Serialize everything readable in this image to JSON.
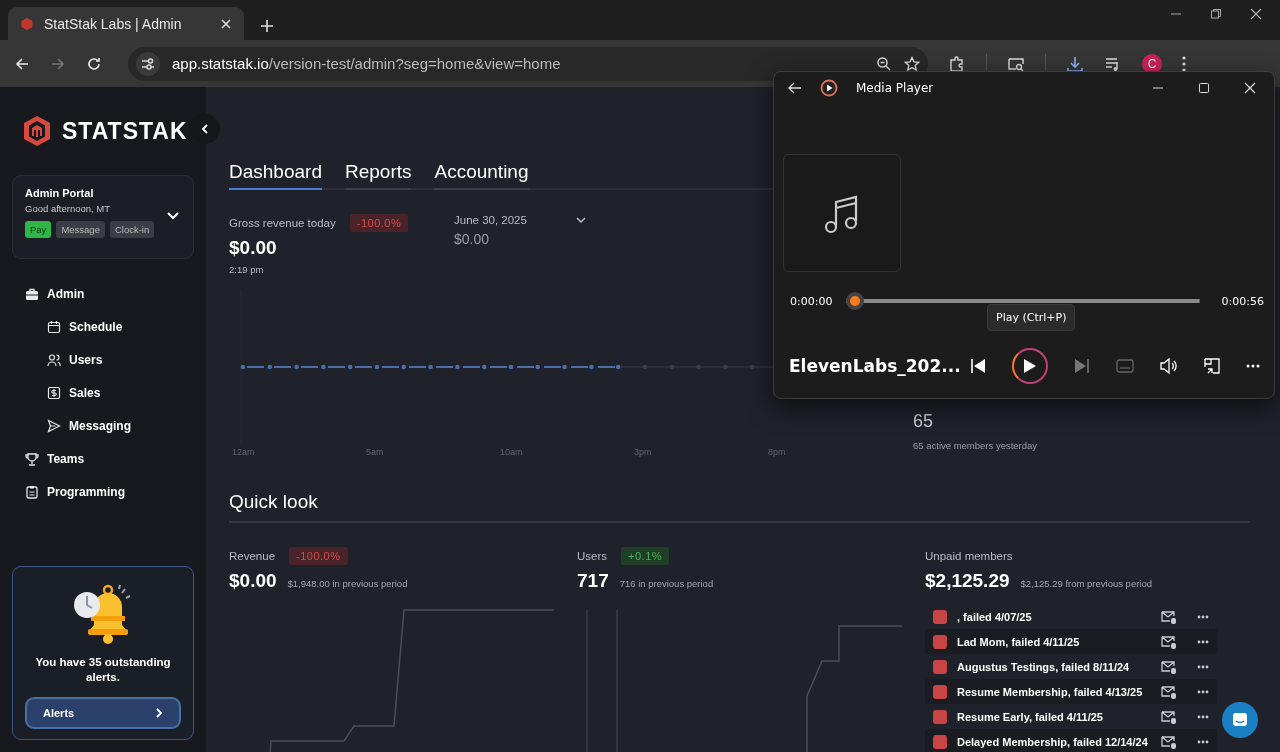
{
  "browser": {
    "tab_title": "StatStak Labs | Admin",
    "url_host": "app.statstak.io",
    "url_path": "/version-test/admin?seg=home&view=home",
    "profile_initial": "C"
  },
  "sidebar": {
    "logo": "STATSTAK",
    "portal": {
      "title": "Admin Portal",
      "greeting": "Good afternoon, MT",
      "actions": [
        {
          "label": "Pay",
          "kind": "primary"
        },
        {
          "label": "Message",
          "kind": "secondary"
        },
        {
          "label": "Clock-in",
          "kind": "secondary"
        }
      ]
    },
    "nav": [
      {
        "label": "Admin",
        "children": [
          {
            "label": "Schedule"
          },
          {
            "label": "Users"
          },
          {
            "label": "Sales"
          },
          {
            "label": "Messaging"
          }
        ]
      },
      {
        "label": "Teams"
      },
      {
        "label": "Programming"
      }
    ],
    "alert": {
      "text": "You have 35 outstanding alerts.",
      "button": "Alerts"
    }
  },
  "tabs": [
    {
      "label": "Dashboard",
      "selected": true
    },
    {
      "label": "Reports",
      "selected": false
    },
    {
      "label": "Accounting",
      "selected": false
    }
  ],
  "gross": {
    "label": "Gross revenue today",
    "change": "-100.0%",
    "kind": "down",
    "value": "$0.00",
    "time": "2:19 pm",
    "compare_date": "June 30, 2025",
    "compare_value": "$0.00",
    "x_labels": [
      "12am",
      "5am",
      "10am",
      "3pm",
      "8pm"
    ]
  },
  "active_members": {
    "value": "65",
    "note": "65 active members yesterday"
  },
  "quick_look": {
    "title": "Quick look",
    "cards": [
      {
        "label": "Revenue",
        "change": "-100.0%",
        "kind": "down",
        "value": "$0.00",
        "note": "$1,948.00 in previous period"
      },
      {
        "label": "Users",
        "change": "+0.1%",
        "kind": "up",
        "value": "717",
        "note": "716 in previous period"
      },
      {
        "label": "Unpaid members",
        "value": "$2,125.29",
        "note": "$2,125.29 from previous period"
      }
    ],
    "unpaid_rows": [
      {
        "text": ", failed 4/07/25"
      },
      {
        "text": "Lad Mom, failed 4/11/25"
      },
      {
        "text": "Augustus Testings, failed 8/11/24"
      },
      {
        "text": "Resume Membership, failed 4/13/25"
      },
      {
        "text": "Resume Early, failed 4/11/25"
      },
      {
        "text": "Delayed Membership, failed 12/14/24"
      }
    ]
  },
  "media_player": {
    "title": "Media Player",
    "elapsed": "0:00:00",
    "duration": "0:00:56",
    "level": 0,
    "track": "ElevenLabs_202...",
    "tooltip": "Play (Ctrl+P)"
  }
}
